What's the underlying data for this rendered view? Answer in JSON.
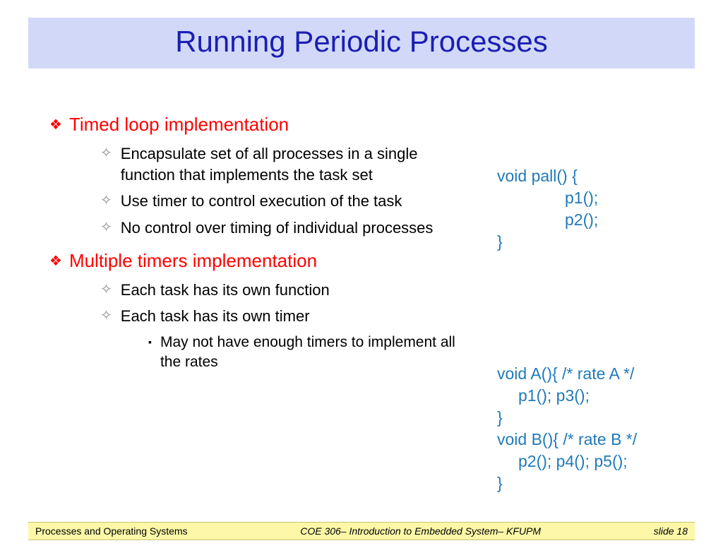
{
  "title": "Running Periodic Processes",
  "sections": [
    {
      "heading": "Timed loop implementation",
      "items": [
        "Encapsulate set of all processes in a single function that implements the task set",
        "Use timer to control execution of the task",
        "No control over timing of individual processes"
      ]
    },
    {
      "heading": "Multiple timers implementation",
      "items": [
        "Each task has its own function",
        "Each task has its own timer"
      ],
      "subitems": [
        "May not have enough timers to implement all the rates"
      ]
    }
  ],
  "code1": {
    "l0": "void pall() {",
    "l1": "p1();",
    "l2": "p2();",
    "l3": "}"
  },
  "code2": {
    "l0": "void A(){ /* rate A */",
    "l1": "p1(); p3();",
    "l2": "}",
    "l3": "void B(){ /* rate B */",
    "l4": "p2(); p4(); p5();",
    "l5": "}"
  },
  "footer": {
    "left": "Processes and Operating Systems",
    "mid": "COE 306– Introduction to Embedded System– KFUPM",
    "right": "slide 18"
  }
}
